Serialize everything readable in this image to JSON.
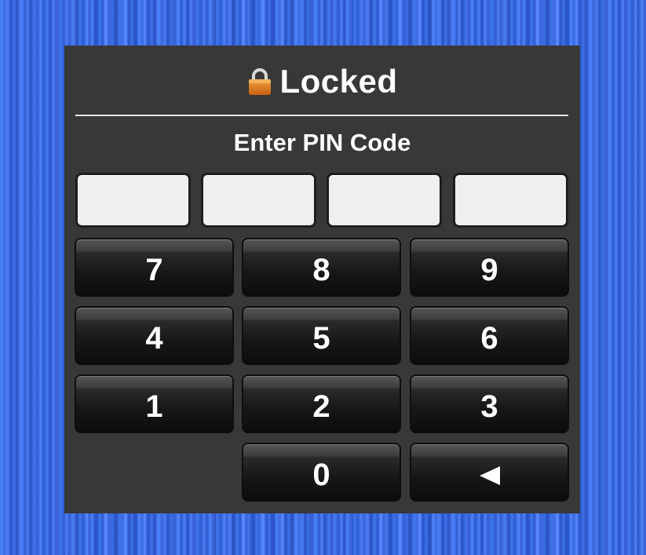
{
  "lock_screen": {
    "title": "Locked",
    "prompt": "Enter PIN Code",
    "pin_digits": [
      "",
      "",
      "",
      ""
    ],
    "keypad": {
      "keys": [
        {
          "label": "7"
        },
        {
          "label": "8"
        },
        {
          "label": "9"
        },
        {
          "label": "4"
        },
        {
          "label": "5"
        },
        {
          "label": "6"
        },
        {
          "label": "1"
        },
        {
          "label": "2"
        },
        {
          "label": "3"
        },
        {
          "label": "0"
        }
      ],
      "backspace_icon": "backspace-arrow-icon"
    },
    "icons": {
      "title_icon": "lock-icon"
    },
    "colors": {
      "panel": "#383838",
      "lock_icon": "#e07a1e",
      "pin_box": "#efefef",
      "background": "#3f78f5"
    }
  }
}
